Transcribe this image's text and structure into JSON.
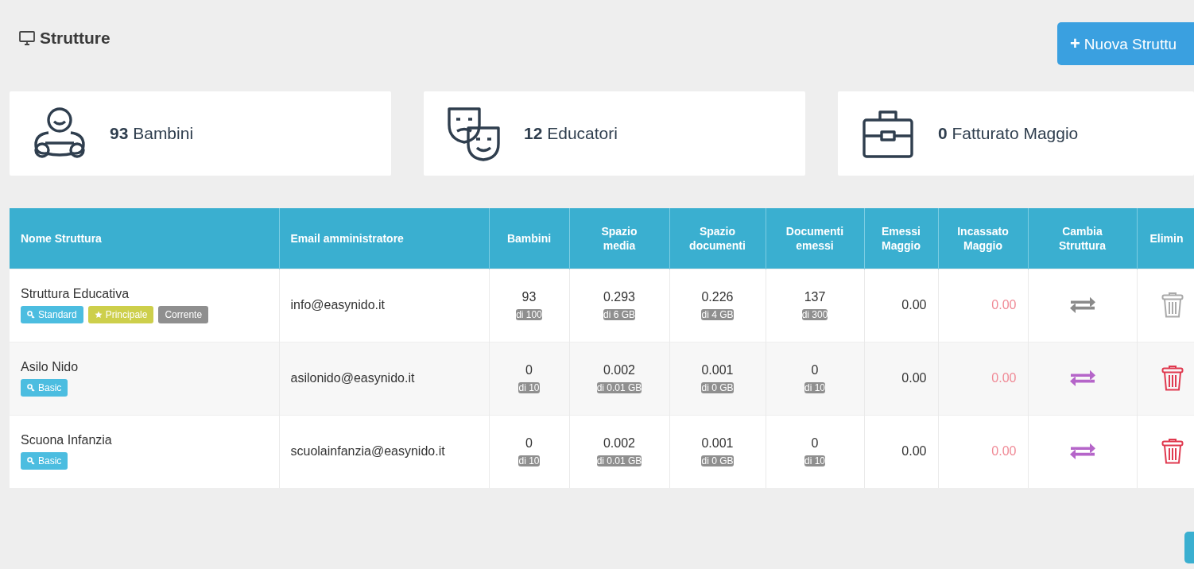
{
  "page": {
    "title": "Strutture",
    "new_button_icon": "+",
    "new_button": "Nuova Struttu"
  },
  "stats": [
    {
      "kind": "children",
      "count": "93",
      "label": "Bambini"
    },
    {
      "kind": "educators",
      "count": "12",
      "label": "Educatori"
    },
    {
      "kind": "revenue",
      "count": "0",
      "label": "Fatturato Maggio"
    }
  ],
  "table": {
    "columns": [
      "Nome Struttura",
      "Email amministratore",
      "Bambini",
      "Spazio media",
      "Spazio documenti",
      "Documenti emessi",
      "Emessi Maggio",
      "Incassato Maggio",
      "Cambia Struttura",
      "Elimin"
    ],
    "rows": [
      {
        "name": "Struttura Educativa",
        "tags": [
          {
            "kind": "plan",
            "label": "Standard"
          },
          {
            "kind": "main",
            "label": "Principale"
          },
          {
            "kind": "current",
            "label": "Corrente"
          }
        ],
        "email": "info@easynido.it",
        "children": {
          "value": "93",
          "limit": "di 100"
        },
        "media": {
          "value": "0.293",
          "limit": "di 6 GB"
        },
        "documents": {
          "value": "0.226",
          "limit": "di 4 GB"
        },
        "issued": {
          "value": "137",
          "limit": "di 300"
        },
        "issued_month": "0.00",
        "cashed_month": "0.00",
        "current": true
      },
      {
        "name": "Asilo Nido",
        "tags": [
          {
            "kind": "plan",
            "label": "Basic"
          }
        ],
        "email": "asilonido@easynido.it",
        "children": {
          "value": "0",
          "limit": "di 10"
        },
        "media": {
          "value": "0.002",
          "limit": "di 0.01 GB"
        },
        "documents": {
          "value": "0.001",
          "limit": "di 0 GB"
        },
        "issued": {
          "value": "0",
          "limit": "di 10"
        },
        "issued_month": "0.00",
        "cashed_month": "0.00",
        "current": false
      },
      {
        "name": "Scuona Infanzia",
        "tags": [
          {
            "kind": "plan",
            "label": "Basic"
          }
        ],
        "email": "scuolainfanzia@easynido.it",
        "children": {
          "value": "0",
          "limit": "di 10"
        },
        "media": {
          "value": "0.002",
          "limit": "di 0.01 GB"
        },
        "documents": {
          "value": "0.001",
          "limit": "di 0 GB"
        },
        "issued": {
          "value": "0",
          "limit": "di 10"
        },
        "issued_month": "0.00",
        "cashed_month": "0.00",
        "current": false
      }
    ]
  }
}
